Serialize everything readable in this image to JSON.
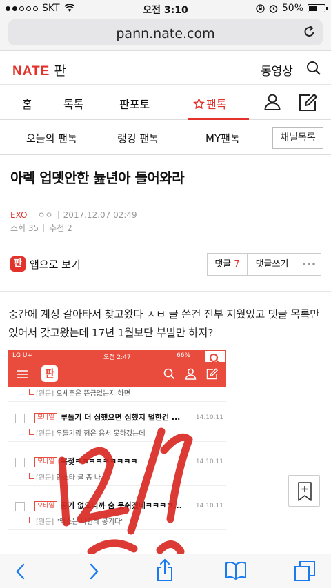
{
  "status_bar": {
    "carrier": "SKT",
    "time": "오전 3:10",
    "battery_percent": "50%",
    "battery_level": 0.5
  },
  "browser": {
    "url": "pann.nate.com"
  },
  "header": {
    "logo_brand": "NATE",
    "logo_section": "판",
    "video_link": "동영상"
  },
  "main_nav": {
    "items": [
      "홈",
      "톡톡",
      "판포토",
      "팬톡"
    ],
    "active_index": 3
  },
  "sub_nav": {
    "items": [
      "오늘의 팬톡",
      "랭킹 팬톡",
      "MY팬톡"
    ],
    "channel_list": "채널목록"
  },
  "post": {
    "title": "아렉 업뎃안한 늂년아 들어와라",
    "category": "EXO",
    "author": "ㅇㅇ",
    "date": "2017.12.07 02:49",
    "views": "조회 35",
    "recommend": "추천 2",
    "app_view": "앱으로 보기",
    "comment_label": "댓글",
    "comment_count": "7",
    "write_comment": "댓글쓰기",
    "body": "중간에 계정 갈아타서 찾고왔다 ㅅㅂ 글 쓴건 전부 지웠었고 댓글 목록만 있어서 갖고왔는데 17년 1월보단 부빌만 하지?"
  },
  "embedded_screenshot": {
    "carrier": "LG U+",
    "time": "오전 2:47",
    "battery": "66%",
    "logo": "판",
    "rows": [
      {
        "kind": "reply",
        "tag": "[원문]",
        "text": "오세훈은 뜬금없는지 하면"
      },
      {
        "kind": "post",
        "tag": "모바일",
        "title": "루돌기 더 심했으면 심했지 덜한건 ...",
        "date": "14.10.11"
      },
      {
        "kind": "reply",
        "tag": "[원문]",
        "text": "우돌기랑 혐은 용서 못하겠는데"
      },
      {
        "kind": "post",
        "tag": "모바일",
        "title": "목젖ㅋㅋㅋㅋㅋㅋㅋㅋㅋ",
        "date": "14.10.11"
      },
      {
        "kind": "reply",
        "tag": "[원문]",
        "text": "인스타 글 좀 나"
      },
      {
        "kind": "post",
        "tag": "모바일",
        "title": "공기 없으니까 숨 못쉬겠네ㅋㅋㅋㄱ...",
        "date": "14.10.11"
      },
      {
        "kind": "reply",
        "tag": "[원문]",
        "text": "\"엑소는 나한테 공기다\""
      }
    ],
    "handwriting": "12/1"
  },
  "colors": {
    "brand_red": "#e2322b",
    "embed_red": "#e94b3c",
    "ink_red": "#d8261f"
  },
  "icons": [
    "wifi-icon",
    "reload-icon",
    "search-icon",
    "star-icon",
    "profile-icon",
    "pencil-icon",
    "bookmark-icon",
    "back-icon",
    "forward-icon",
    "share-icon",
    "bookmarks-book-icon",
    "tabs-icon"
  ]
}
